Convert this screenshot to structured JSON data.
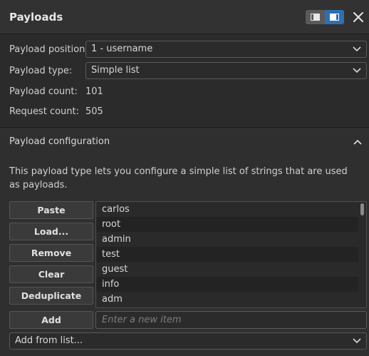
{
  "header": {
    "title": "Payloads"
  },
  "fields": {
    "position_label": "Payload position:",
    "position_value": "1 - username",
    "type_label": "Payload type:",
    "type_value": "Simple list",
    "payload_count_label": "Payload count:",
    "payload_count": "101",
    "request_count_label": "Request count:",
    "request_count": "505"
  },
  "config": {
    "title": "Payload configuration",
    "description": "This payload type lets you configure a simple list of strings that are used as payloads.",
    "buttons": {
      "paste": "Paste",
      "load": "Load...",
      "remove": "Remove",
      "clear": "Clear",
      "deduplicate": "Deduplicate",
      "add": "Add"
    },
    "items": [
      "carlos",
      "root",
      "admin",
      "test",
      "guest",
      "info",
      "adm"
    ],
    "new_item_placeholder": "Enter a new item",
    "add_from_list": "Add from list..."
  },
  "colors": {
    "background": "#2b2b2b",
    "accent": "#2e6fb2",
    "text": "#d6d6d6"
  }
}
